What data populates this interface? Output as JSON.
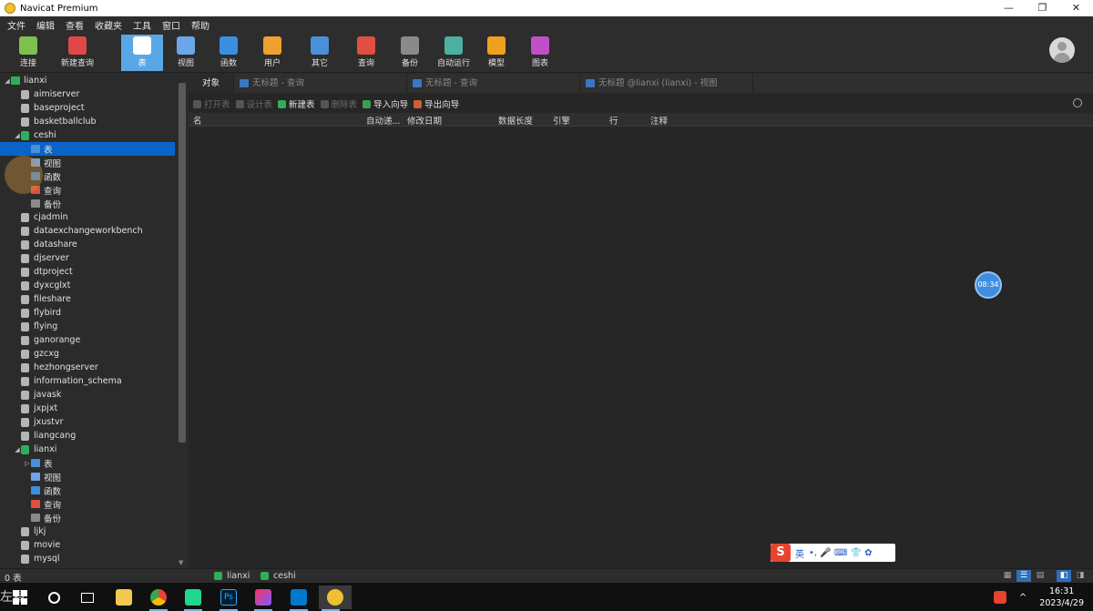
{
  "window": {
    "title": "Navicat Premium",
    "controls": [
      "—",
      "❐",
      "✕"
    ]
  },
  "menu": [
    "文件",
    "编辑",
    "查看",
    "收藏夹",
    "工具",
    "窗口",
    "帮助"
  ],
  "toolbar": [
    {
      "label": "连接",
      "icon": "connection-icon",
      "color": "#7fbf4f"
    },
    {
      "label": "新建查询",
      "icon": "new-query-icon",
      "color": "#e04848"
    },
    {
      "label": "表",
      "icon": "table-icon",
      "color": "#ffffff",
      "active": true
    },
    {
      "label": "视图",
      "icon": "view-icon",
      "color": "#6aa6e8"
    },
    {
      "label": "函数",
      "icon": "function-icon",
      "color": "#3a8fe0"
    },
    {
      "label": "用户",
      "icon": "user-icon",
      "color": "#f0a030"
    },
    {
      "label": "其它",
      "icon": "other-icon",
      "color": "#4a90d9"
    },
    {
      "label": "查询",
      "icon": "query-icon",
      "color": "#e05040"
    },
    {
      "label": "备份",
      "icon": "backup-icon",
      "color": "#8a8a8a"
    },
    {
      "label": "自动运行",
      "icon": "robot-icon",
      "color": "#4cb0a0"
    },
    {
      "label": "模型",
      "icon": "model-icon",
      "color": "#f0a020"
    },
    {
      "label": "图表",
      "icon": "chart-icon",
      "color": "#c050c8"
    }
  ],
  "tree": [
    {
      "label": "lianxi",
      "level": 0,
      "kind": "conn",
      "arrow": "◢"
    },
    {
      "label": "aimiserver",
      "level": 1,
      "kind": "db"
    },
    {
      "label": "baseproject",
      "level": 1,
      "kind": "db"
    },
    {
      "label": "basketballclub",
      "level": 1,
      "kind": "db"
    },
    {
      "label": "ceshi",
      "level": 1,
      "kind": "dbopen",
      "arrow": "◢"
    },
    {
      "label": "表",
      "level": 2,
      "kind": "table",
      "selected": true
    },
    {
      "label": "视图",
      "level": 2,
      "kind": "view"
    },
    {
      "label": "函数",
      "level": 2,
      "kind": "func"
    },
    {
      "label": "查询",
      "level": 2,
      "kind": "query"
    },
    {
      "label": "备份",
      "level": 2,
      "kind": "backup"
    },
    {
      "label": "cjadmin",
      "level": 1,
      "kind": "db"
    },
    {
      "label": "dataexchangeworkbench",
      "level": 1,
      "kind": "db"
    },
    {
      "label": "datashare",
      "level": 1,
      "kind": "db"
    },
    {
      "label": "djserver",
      "level": 1,
      "kind": "db"
    },
    {
      "label": "dtproject",
      "level": 1,
      "kind": "db"
    },
    {
      "label": "dyxcglxt",
      "level": 1,
      "kind": "db"
    },
    {
      "label": "fileshare",
      "level": 1,
      "kind": "db"
    },
    {
      "label": "flybird",
      "level": 1,
      "kind": "db"
    },
    {
      "label": "flying",
      "level": 1,
      "kind": "db"
    },
    {
      "label": "ganorange",
      "level": 1,
      "kind": "db"
    },
    {
      "label": "gzcxg",
      "level": 1,
      "kind": "db"
    },
    {
      "label": "hezhongserver",
      "level": 1,
      "kind": "db"
    },
    {
      "label": "information_schema",
      "level": 1,
      "kind": "db"
    },
    {
      "label": "javask",
      "level": 1,
      "kind": "db"
    },
    {
      "label": "jxpjxt",
      "level": 1,
      "kind": "db"
    },
    {
      "label": "jxustvr",
      "level": 1,
      "kind": "db"
    },
    {
      "label": "liangcang",
      "level": 1,
      "kind": "db"
    },
    {
      "label": "lianxi",
      "level": 1,
      "kind": "dbopen",
      "arrow": "◢"
    },
    {
      "label": "表",
      "level": 2,
      "kind": "table",
      "arrow": "▷"
    },
    {
      "label": "视图",
      "level": 2,
      "kind": "view"
    },
    {
      "label": "函数",
      "level": 2,
      "kind": "func"
    },
    {
      "label": "查询",
      "level": 2,
      "kind": "query"
    },
    {
      "label": "备份",
      "level": 2,
      "kind": "backup"
    },
    {
      "label": "ljkj",
      "level": 1,
      "kind": "db"
    },
    {
      "label": "movie",
      "level": 1,
      "kind": "db"
    },
    {
      "label": "mysql",
      "level": 1,
      "kind": "db"
    }
  ],
  "tabs": [
    {
      "label": "对象",
      "active": true
    },
    {
      "label": "无标题 - 查询"
    },
    {
      "label": "无标题 - 查询"
    },
    {
      "label": "无标题 @lianxi (lianxi) - 视图"
    }
  ],
  "object_toolbar": [
    {
      "label": "打开表",
      "enabled": false
    },
    {
      "label": "设计表",
      "enabled": false
    },
    {
      "label": "新建表",
      "enabled": true
    },
    {
      "label": "删除表",
      "enabled": false
    },
    {
      "label": "导入向导",
      "enabled": true
    },
    {
      "label": "导出向导",
      "enabled": true
    }
  ],
  "columns": [
    "名",
    "自动递...",
    "修改日期",
    "数据长度",
    "引擎",
    "行",
    "注释"
  ],
  "timer": "08:34",
  "ime": {
    "logo": "S",
    "lang": "英",
    "extras": "•, 🎤 ⌨ 👕 ✿"
  },
  "status": {
    "count": "0 表",
    "conn1": "lianxi",
    "conn2": "ceshi"
  },
  "taskbar": {
    "left_text": "左看",
    "time": "16:31",
    "date": "2023/4/29",
    "tray_caret": "^"
  }
}
